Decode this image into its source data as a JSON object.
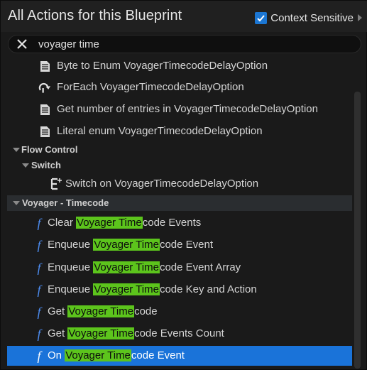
{
  "header": {
    "title": "All Actions for this Blueprint",
    "context_sensitive_label": "Context Sensitive",
    "context_sensitive_checked": true
  },
  "search": {
    "value": "voyager time",
    "clear_icon": "close-icon"
  },
  "list": {
    "items": [
      {
        "kind": "action",
        "icon": "document-icon",
        "label": "Byte to Enum VoyagerTimecodeDelayOption"
      },
      {
        "kind": "action",
        "icon": "loop-icon",
        "label": "ForEach VoyagerTimecodeDelayOption"
      },
      {
        "kind": "action",
        "icon": "document-icon",
        "label": "Get number of entries in VoyagerTimecodeDelayOption"
      },
      {
        "kind": "action",
        "icon": "document-icon",
        "label": "Literal enum VoyagerTimecodeDelayOption"
      }
    ],
    "categories": {
      "flow_control": "Flow Control",
      "switch": "Switch",
      "voyager_timecode": "Voyager - Timecode"
    },
    "switch_item": {
      "icon": "switch-icon",
      "label": "Switch on VoyagerTimecodeDelayOption"
    },
    "functions": [
      {
        "pre": "Clear ",
        "match": "Voyager Time",
        "post": "code Events",
        "selected": false
      },
      {
        "pre": "Enqueue ",
        "match": "Voyager Time",
        "post": "code Event",
        "selected": false
      },
      {
        "pre": "Enqueue ",
        "match": "Voyager Time",
        "post": "code Event Array",
        "selected": false
      },
      {
        "pre": "Enqueue ",
        "match": "Voyager Time",
        "post": "code Key and Action",
        "selected": false
      },
      {
        "pre": "Get ",
        "match": "Voyager Time",
        "post": "code",
        "selected": false
      },
      {
        "pre": "Get ",
        "match": "Voyager Time",
        "post": "code Events Count",
        "selected": false
      },
      {
        "pre": "On ",
        "match": "Voyager Time",
        "post": "code Event",
        "selected": true
      }
    ],
    "function_icon_glyph": "f"
  },
  "colors": {
    "accent": "#1a73d9",
    "highlight": "#5cc41c",
    "function_icon": "#4d8df2"
  }
}
